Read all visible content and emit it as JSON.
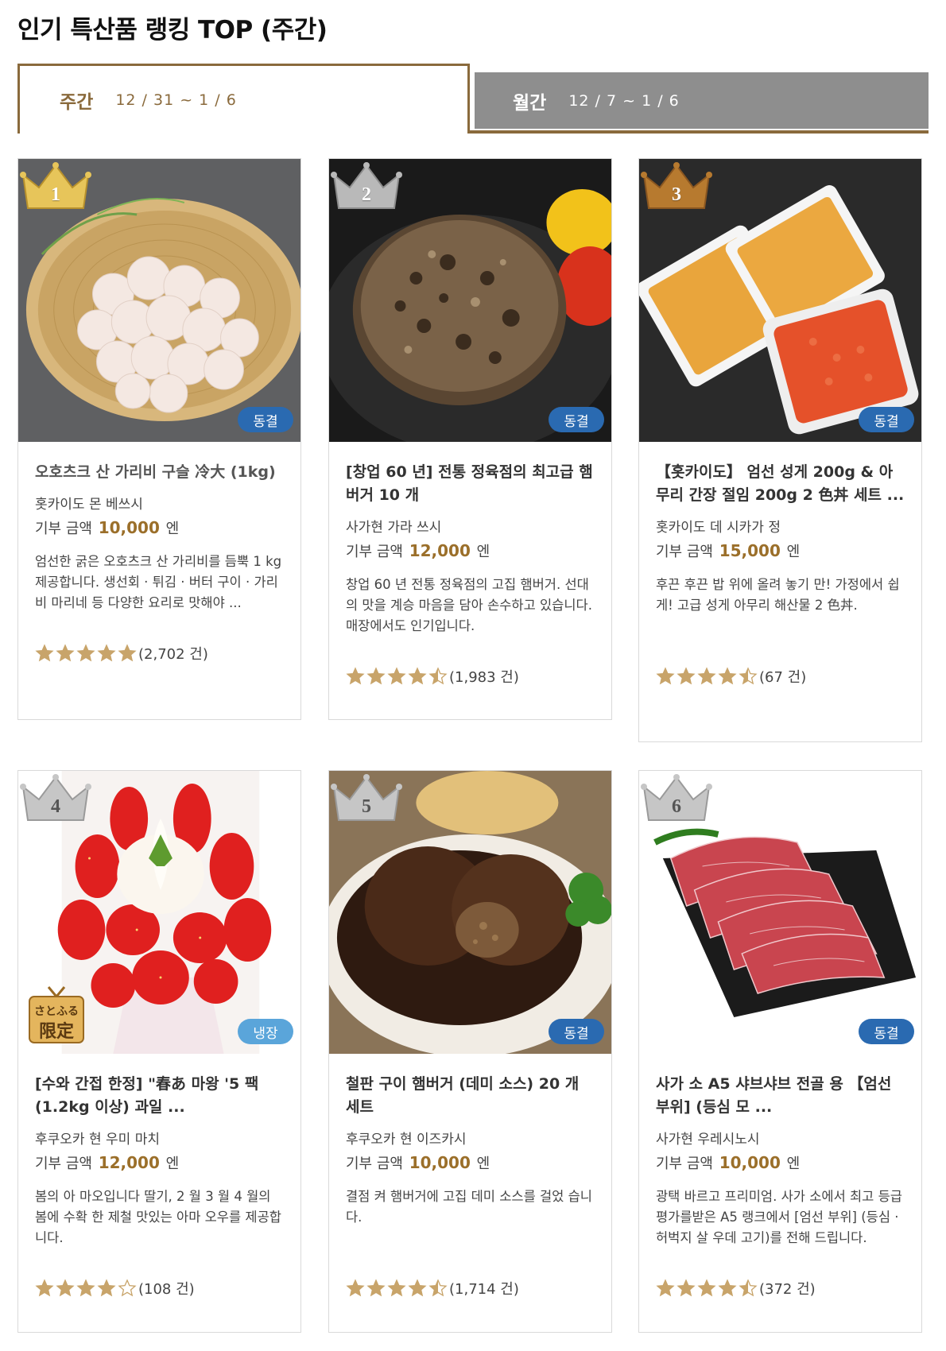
{
  "page": {
    "title": "인기 특산품 랭킹 TOP (주간)"
  },
  "tabs": {
    "weekly": {
      "label": "주간",
      "date": "12 / 31 ~ 1 / 6"
    },
    "monthly": {
      "label": "월간",
      "date": "12 / 7 ~ 1 / 6"
    }
  },
  "colors": {
    "accent": "#8a6a3c",
    "frozen": "#2a6ab1",
    "chilled": "#5aa5da",
    "star": "#c8a46a",
    "inactive_tab": "#8e8e8e"
  },
  "products": [
    {
      "rank": "1",
      "storage": "동결",
      "title": "오호츠크 산 가리비 구슬 冷大 (1kg)",
      "city": "홋카이도 몬 베쓰시",
      "price_label": "기부 금액",
      "price": "10,000",
      "price_unit": "엔",
      "desc": "엄선한 굵은 오호츠크 산 가리비를 듬뿍 1 kg 제공합니다. 생선회 · 튀김 · 버터 구이 · 가리비 마리네 등 다양한 요리로 맛해야 ...",
      "rating": 5,
      "review_count": "(2,702 건)",
      "image": "scallops-photo"
    },
    {
      "rank": "2",
      "storage": "동결",
      "title": "[창업 60 년] 전통 정육점의 최고급 햄버거 10 개",
      "city": "사가현 가라 쓰시",
      "price_label": "기부 금액",
      "price": "12,000",
      "price_unit": "엔",
      "desc": "창업 60 년 전통 정육점의 고집 햄버거. 선대의 맛을 계승 마음을 담아 손수하고 있습니다. 매장에서도 인기입니다.",
      "rating": 4.5,
      "review_count": "(1,983 건)",
      "image": "hamburger-photo"
    },
    {
      "rank": "3",
      "storage": "동결",
      "title": "【홋카이도】 엄선 성게 200g & 아무리 간장 절임 200g 2 色丼 세트 ...",
      "city": "홋카이도 데 시카가 정",
      "price_label": "기부 금액",
      "price": "15,000",
      "price_unit": "엔",
      "desc": "후끈 후끈 밥 위에 올려 놓기 만! 가정에서 쉽게! 고급 성게 아무리 해산물 2 色丼.",
      "rating": 4.5,
      "review_count": "(67 건)",
      "image": "uni-ikura-photo"
    },
    {
      "rank": "4",
      "storage": "냉장",
      "limited_top": "さとふる",
      "limited_bottom": "限定",
      "title": "[수와 간접 한정] \"春あ 마왕 '5 팩 (1.2kg 이상) 과일 ...",
      "city": "후쿠오카 현 우미 마치",
      "price_label": "기부 금액",
      "price": "12,000",
      "price_unit": "엔",
      "desc": "봄의 아 마오입니다 딸기, 2 월 3 월 4 월의 봄에 수확 한 제철 맛있는 아마 오우를 제공합니다.",
      "rating": 4,
      "review_count": "(108 건)",
      "image": "strawberry-parfait-photo"
    },
    {
      "rank": "5",
      "storage": "동결",
      "title": "철판 구이 햄버거 (데미 소스) 20 개 세트",
      "city": "후쿠오카 현 이즈카시",
      "price_label": "기부 금액",
      "price": "10,000",
      "price_unit": "엔",
      "desc": "결점 켜 햄버거에 고집 데미 소스를 걸었 습니다.",
      "rating": 4.5,
      "review_count": "(1,714 건)",
      "image": "demi-hamburger-photo"
    },
    {
      "rank": "6",
      "storage": "동결",
      "title": "사가 소 A5 샤브샤브 전골 용 【엄선 부위] (등심 모 ...",
      "city": "사가현 우레시노시",
      "price_label": "기부 금액",
      "price": "10,000",
      "price_unit": "엔",
      "desc": "광택 바르고 프리미엄. 사가 소에서 최고 등급 평가를받은 A5 랭크에서 [엄선 부위] (등심 · 허벅지 살 우데 고기)를 전해 드립니다.",
      "rating": 4.5,
      "review_count": "(372 건)",
      "image": "wagyu-beef-photo"
    }
  ]
}
